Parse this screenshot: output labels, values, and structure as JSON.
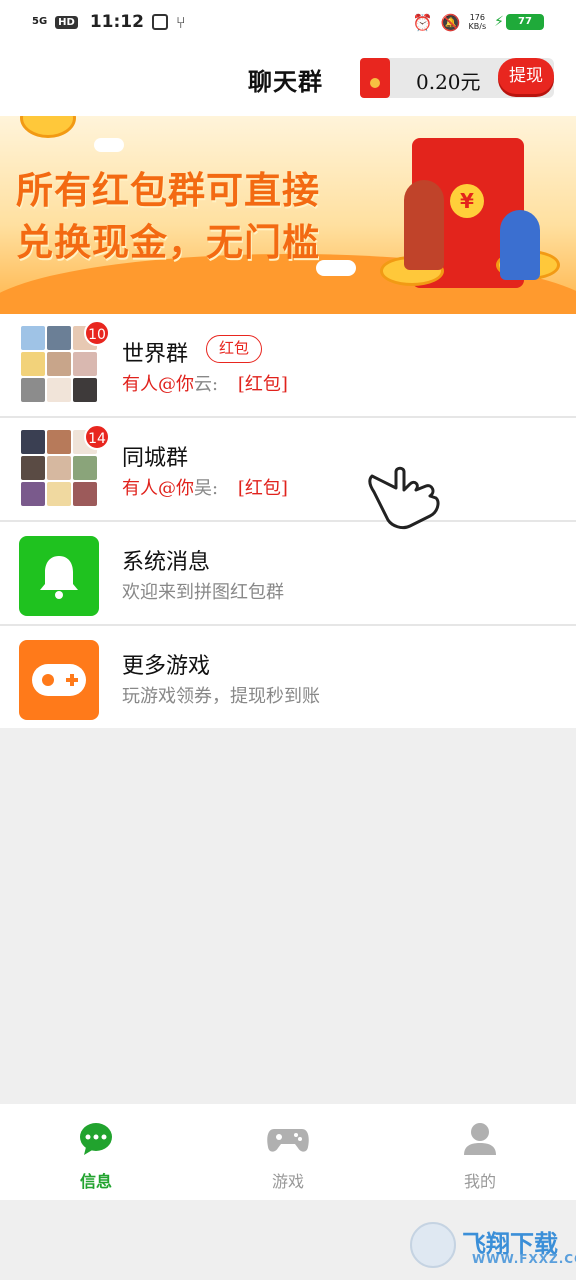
{
  "status_bar": {
    "network": "5G",
    "hd": "HD",
    "time": "11:12",
    "net_speed_value": "176",
    "net_speed_unit": "KB/s",
    "battery": "77"
  },
  "header": {
    "title": "聊天群",
    "balance": "0.20元",
    "withdraw_label": "提现"
  },
  "banner": {
    "line1": "所有红包群可直接",
    "line2": "兑换现金，无门槛"
  },
  "chats": [
    {
      "title": "世界群",
      "tag": "红包",
      "badge": "10",
      "mention": "有人@你",
      "sender": "云:",
      "message": "[红包]"
    },
    {
      "title": "同城群",
      "badge": "14",
      "mention": "有人@你",
      "sender": "吴:",
      "message": "[红包]"
    },
    {
      "title": "系统消息",
      "subtitle": "欢迎来到拼图红包群",
      "icon": "bell-icon",
      "icon_color": "#1fc21f"
    },
    {
      "title": "更多游戏",
      "subtitle": "玩游戏领券，提现秒到账",
      "icon": "gamepad-icon",
      "icon_color": "#ff7a1a"
    }
  ],
  "bottom_nav": [
    {
      "label": "信息",
      "icon": "chat-bubble-icon",
      "active": true
    },
    {
      "label": "游戏",
      "icon": "gamepad-icon",
      "active": false
    },
    {
      "label": "我的",
      "icon": "person-icon",
      "active": false
    }
  ],
  "colors": {
    "accent_red": "#e8261f",
    "active_green": "#21a32e",
    "banner_orange": "#f36a12"
  },
  "watermark": {
    "line1": "飞翔下载",
    "line2": "WWW.FXXZ.COM"
  }
}
